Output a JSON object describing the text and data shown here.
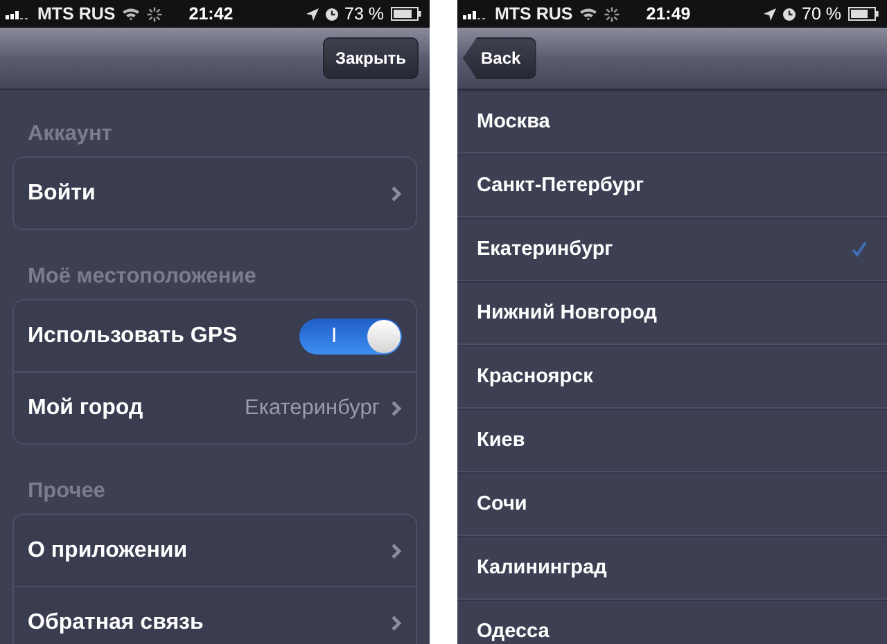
{
  "settings_screen": {
    "status_bar": {
      "carrier": "MTS RUS",
      "time": "21:42",
      "battery": "73 %"
    },
    "nav_button": "Закрыть",
    "sections": [
      {
        "header": "Аккаунт",
        "rows": [
          {
            "kind": "link",
            "label": "Войти"
          }
        ]
      },
      {
        "header": "Моё местоположение",
        "rows": [
          {
            "kind": "switch",
            "label": "Использовать GPS",
            "on": true,
            "on_label": "I"
          },
          {
            "kind": "link",
            "label": "Мой город",
            "value": "Екатеринбург"
          }
        ]
      },
      {
        "header": "Прочее",
        "rows": [
          {
            "kind": "link",
            "label": "О приложении"
          },
          {
            "kind": "link",
            "label": "Обратная связь"
          }
        ]
      }
    ]
  },
  "city_screen": {
    "status_bar": {
      "carrier": "MTS RUS",
      "time": "21:49",
      "battery": "70 %"
    },
    "back_button": "Back",
    "cities": [
      {
        "name": "Москва",
        "selected": false
      },
      {
        "name": "Санкт-Петербург",
        "selected": false
      },
      {
        "name": "Екатеринбург",
        "selected": true
      },
      {
        "name": "Нижний Новгород",
        "selected": false
      },
      {
        "name": "Красноярск",
        "selected": false
      },
      {
        "name": "Киев",
        "selected": false
      },
      {
        "name": "Сочи",
        "selected": false
      },
      {
        "name": "Калининград",
        "selected": false
      },
      {
        "name": "Одесса",
        "selected": false
      }
    ]
  }
}
